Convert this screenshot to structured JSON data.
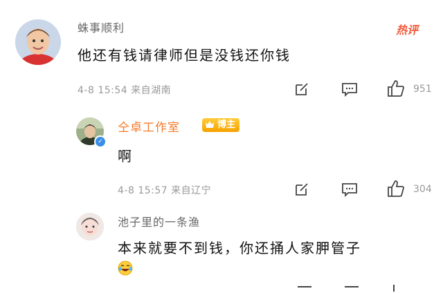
{
  "header": {
    "hot_label": "热评"
  },
  "comments": [
    {
      "username": "蛛事顺利",
      "text": "他还有钱请律师但是没钱还你钱",
      "meta": "4-8 15:54 来自湖南",
      "like_count": "951"
    },
    {
      "username": "仝卓工作室",
      "badge": "博主",
      "text": "啊",
      "meta": "4-8 15:57 来自辽宁",
      "like_count": "304"
    },
    {
      "username": "池子里的一条渔",
      "text": "本来就要不到钱，你还捅人家胛管子"
    }
  ],
  "icons": {
    "edit": "edit-icon",
    "comment": "comment-icon",
    "like": "thumbs-up-icon",
    "laugh": "laugh-cry-emoji-icon"
  },
  "colors": {
    "accent_orange": "#f77a2a",
    "hot_red": "#f25a3a",
    "meta_gray": "#999999",
    "verify_blue": "#3a8ee6"
  }
}
